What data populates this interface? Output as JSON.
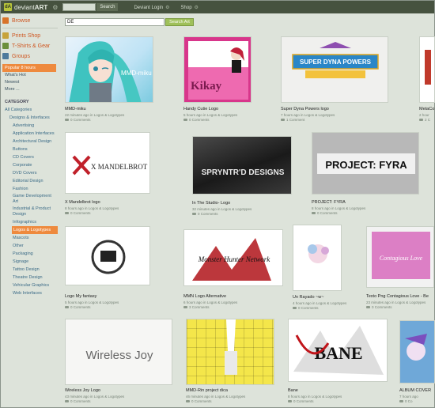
{
  "topbar": {
    "brand_prefix": "deviant",
    "brand_suffix": "ART",
    "search_button": "Search",
    "login_link": "Deviant Login",
    "shop_link": "Shop"
  },
  "sidebar": {
    "browse": "Browse",
    "prints": "Prints Shop",
    "shirts": "T-Shirts & Gear",
    "groups": "Groups",
    "popular": "Popular 8 hours",
    "whats_hot": "What's Hot",
    "newest": "Newest",
    "more": "More ...",
    "category_heading": "CATEGORY",
    "all_categories": "All Categories",
    "designs": "Designs & Interfaces",
    "cat": [
      "Advertising",
      "Application Interfaces",
      "Architectural Design",
      "Buttons",
      "CD Covers",
      "Corporate",
      "DVD Covers",
      "Editorial Design",
      "Fashion",
      "Game Development Art",
      "Industrial & Product Design",
      "Infographics",
      "Logos & Logotypes",
      "Mascots",
      "Other",
      "Packaging",
      "Signage",
      "Tattoo Design",
      "Theatre Design",
      "Vehicular Graphics",
      "Web Interfaces"
    ]
  },
  "search": {
    "value": "DE",
    "button": "Search Art"
  },
  "thumbs": [
    {
      "title": "MMD-miku",
      "meta": "22 minutes ago in Logos & Logotypes",
      "comments": "0 Comments",
      "art": "MMD-miku"
    },
    {
      "title": "Handy Cutie Logo",
      "meta": "5 hours ago in Logos & Logotypes",
      "comments": "0 Comments",
      "art": "Kikay"
    },
    {
      "title": "Super Dyna Powers logo",
      "meta": "7 hours ago in Logos & Logotypes",
      "comments": "1 Comment",
      "art": "SUPER DYNA POWERS"
    },
    {
      "title": "MetaCo",
      "meta": "2 hour",
      "comments": "2 C",
      "art": ""
    },
    {
      "title": "X Mandelbrot logo",
      "meta": "8 hours ago in Logos & Logotypes",
      "comments": "0 Comments",
      "art": "X MANDELBROT"
    },
    {
      "title": "In The Studio- Logo",
      "meta": "32 minutes ago in Logos & Logotypes",
      "comments": "0 Comments",
      "art": "SPRYNTR'D DESIGNS"
    },
    {
      "title": "PROJECT: FYRA",
      "meta": "8 hours ago in Logos & Logotypes",
      "comments": "0 Comments",
      "art": "PROJECT: FYRA"
    },
    {
      "title": "Logo My fantasy",
      "meta": "5 hours ago in Logos & Logotypes",
      "comments": "0 Comments",
      "art": ""
    },
    {
      "title": "MMN Logo Alternative",
      "meta": "6 hours ago in Logos & Logotypes",
      "comments": "3 Comments",
      "art": "Monster Hunter Network"
    },
    {
      "title": "Un Rayado ~w~",
      "meta": "4 hours ago in Logos & Logotypes",
      "comments": "0 Comments",
      "art": ""
    },
    {
      "title": "Texto Png Contagious Love - Be",
      "meta": "23 minutes ago in Logos & Logotypes",
      "comments": "0 Comments",
      "art": "Contagious Love"
    },
    {
      "title": "Wireless Joy Logo",
      "meta": "43 minutes ago in Logos & Logotypes",
      "comments": "0 Comments",
      "art": "Wireless Joy"
    },
    {
      "title": "MMD-Rin project dica",
      "meta": "46 minutes ago in Logos & Logotypes",
      "comments": "0 Comments",
      "art": ""
    },
    {
      "title": "Bane",
      "meta": "8 hours ago in Logos & Logotypes",
      "comments": "0 Comments",
      "art": "BANE"
    },
    {
      "title": "ALBUM COVER",
      "meta": "7 hours ago",
      "comments": "0 Co",
      "art": ""
    }
  ]
}
